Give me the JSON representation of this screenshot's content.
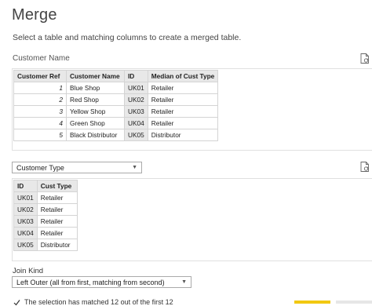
{
  "dialog": {
    "title": "Merge",
    "subtitle": "Select a table and matching columns to create a merged table."
  },
  "first_table": {
    "label": "Customer Name",
    "columns": [
      "Customer Ref",
      "Customer Name",
      "ID",
      "Median of Cust Type"
    ],
    "rows": [
      [
        "1",
        "Blue Shop",
        "UK01",
        "Retailer"
      ],
      [
        "2",
        "Red Shop",
        "UK02",
        "Retailer"
      ],
      [
        "3",
        "Yellow Shop",
        "UK03",
        "Retailer"
      ],
      [
        "4",
        "Green Shop",
        "UK04",
        "Retailer"
      ],
      [
        "5",
        "Black Distributor",
        "UK05",
        "Distributor"
      ]
    ]
  },
  "second_table": {
    "selected": "Customer Type",
    "columns": [
      "ID",
      "Cust Type"
    ],
    "rows": [
      [
        "UK01",
        "Retailer"
      ],
      [
        "UK02",
        "Retailer"
      ],
      [
        "UK03",
        "Retailer"
      ],
      [
        "UK04",
        "Retailer"
      ],
      [
        "UK05",
        "Distributor"
      ]
    ]
  },
  "join": {
    "label": "Join Kind",
    "selected": "Left Outer (all from first, matching from second)"
  },
  "status": {
    "text": "The selection has matched 12 out of the first 12"
  },
  "colors": {
    "ok_button": "#f2c811",
    "header_bg": "#e8e8e8"
  }
}
